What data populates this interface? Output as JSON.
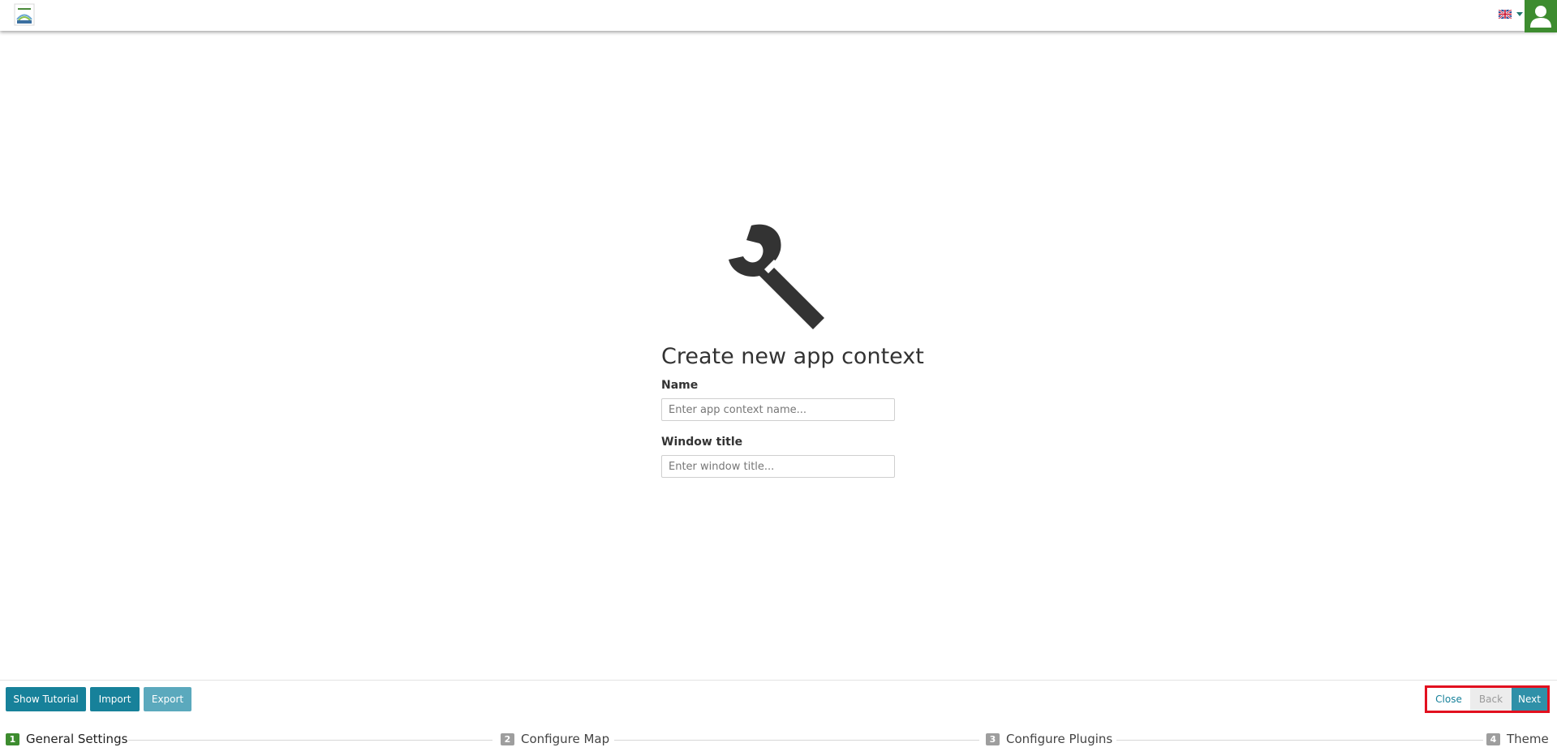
{
  "header": {
    "logo_icon": "app-logo",
    "language_icon": "uk-flag-icon",
    "user_icon": "user-icon",
    "colors": {
      "user_button": "#3d8c2f"
    }
  },
  "main": {
    "icon": "wrench-icon",
    "title": "Create new app context",
    "name_label": "Name",
    "name_placeholder": "Enter app context name...",
    "window_title_label": "Window title",
    "window_title_placeholder": "Enter window title..."
  },
  "footer": {
    "show_tutorial": "Show Tutorial",
    "import": "Import",
    "export": "Export",
    "close": "Close",
    "back": "Back",
    "next": "Next"
  },
  "steps": [
    {
      "number": "1",
      "label": "General Settings",
      "active": true
    },
    {
      "number": "2",
      "label": "Configure Map",
      "active": false
    },
    {
      "number": "3",
      "label": "Configure Plugins",
      "active": false
    },
    {
      "number": "4",
      "label": "Theme",
      "active": false
    }
  ],
  "colors": {
    "primary": "#17819a",
    "accent_green": "#3d8c2f",
    "highlight": "#e2101f"
  }
}
